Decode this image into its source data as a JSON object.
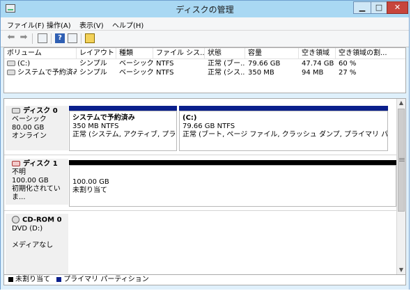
{
  "window": {
    "title": "ディスクの管理"
  },
  "menu": [
    "ファイル(F)",
    "操作(A)",
    "表示(V)",
    "ヘルプ(H)"
  ],
  "toolbar": {
    "back_icon": "back-arrow-icon",
    "forward_icon": "forward-arrow-icon",
    "help_glyph": "?"
  },
  "volume_table": {
    "columns": [
      "ボリューム",
      "レイアウト",
      "種類",
      "ファイル シス...",
      "状態",
      "容量",
      "空き領域",
      "空き領域の割..."
    ],
    "rows": [
      [
        "(C:)",
        "シンプル",
        "ベーシック",
        "NTFS",
        "正常 (ブー...",
        "79.66 GB",
        "47.74 GB",
        "60 %"
      ],
      [
        "システムで予約済み",
        "シンプル",
        "ベーシック",
        "NTFS",
        "正常 (シス...",
        "350 MB",
        "94 MB",
        "27 %"
      ]
    ]
  },
  "disks": [
    {
      "name": "ディスク 0",
      "lines": [
        "ベーシック",
        "80.00 GB",
        "オンライン"
      ],
      "partitions": [
        {
          "title": "システムで予約済み",
          "size": "350 MB NTFS",
          "status": "正常 (システム, アクティブ, プライマリ パ"
        },
        {
          "title": "(C:)",
          "size": "79.66 GB NTFS",
          "status": "正常 (ブート, ページ ファイル, クラッシュ ダンプ, プライマリ パーティション)"
        }
      ]
    },
    {
      "name": "ディスク 1",
      "lines": [
        "不明",
        "100.00 GB",
        "初期化されていま..."
      ],
      "partitions": [
        {
          "size": "100.00 GB",
          "status": "未割り当て"
        }
      ]
    },
    {
      "name": "CD-ROM 0",
      "lines": [
        "DVD (D:)",
        "",
        "メディアなし"
      ]
    }
  ],
  "legend": [
    {
      "label": "未割り当て",
      "color": "#000000"
    },
    {
      "label": "プライマリ パーティション",
      "color": "#0a1f8c"
    }
  ],
  "colors": {
    "titlebar": "#a9d8f3",
    "primary_partition": "#0a1f8c",
    "unallocated": "#000000",
    "close_button": "#c7453c"
  }
}
